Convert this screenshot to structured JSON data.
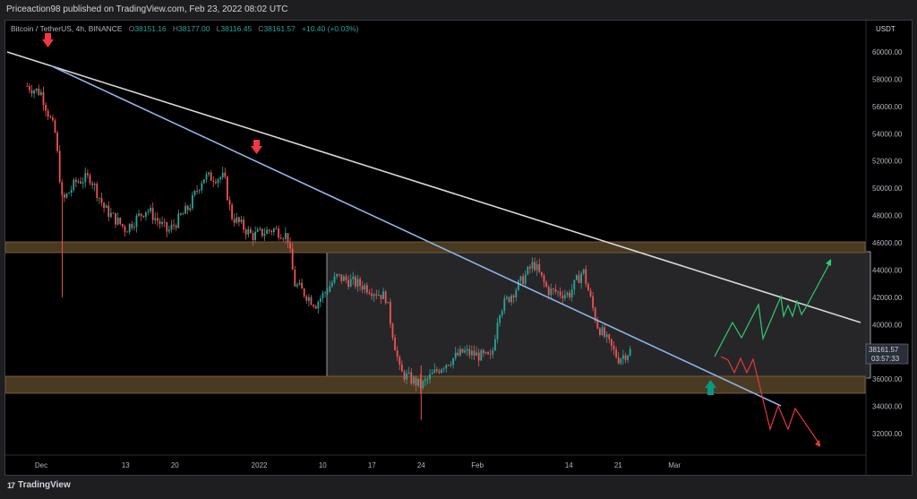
{
  "header": {
    "published": "Priceaction98 published on TradingView.com, Feb 23, 2022 08:02 UTC"
  },
  "legend": {
    "symbol": "Bitcoin / TetherUS, 4h, BINANCE",
    "o_label": "O",
    "o_value": "38151.16",
    "h_label": "H",
    "h_value": "38177.00",
    "l_label": "L",
    "l_value": "38116.45",
    "c_label": "C",
    "c_value": "38161.57",
    "change": "+10.40 (+0.03%)"
  },
  "branding": {
    "name": "TradingView",
    "mark": "17"
  },
  "price_tag": {
    "price": "38161.57",
    "countdown": "03:57:33"
  },
  "colors": {
    "up": "#26a69a",
    "down": "#ef5350",
    "zone": "#4a3a22",
    "range_box": "#262628",
    "white_line": "#d8d8d8",
    "blue_line": "#8cb4e8",
    "green_path": "#2ecc71",
    "red_path": "#e53935",
    "arrow_red": "#f23645",
    "arrow_green": "#089981"
  },
  "chart_data": {
    "type": "candlestick",
    "currency": "USDT",
    "x_ticks": [
      "Dec",
      "13",
      "20",
      "2022",
      "10",
      "17",
      "24",
      "Feb",
      "14",
      "21",
      "Mar"
    ],
    "y_ticks": [
      "60000.00",
      "58000.00",
      "56000.00",
      "54000.00",
      "52000.00",
      "50000.00",
      "48000.00",
      "46000.00",
      "44000.00",
      "42000.00",
      "40000.00",
      "38000.00",
      "36000.00",
      "34000.00",
      "32000.00"
    ],
    "ylim": [
      31000,
      62000
    ],
    "series": [
      {
        "values": [
          {
            "x": "Nov 29",
            "close": 57500
          },
          {
            "x": "Dec 1",
            "close": 57000
          },
          {
            "x": "Dec 3",
            "close": 54000
          },
          {
            "x": "Dec 4",
            "close": 49000
          },
          {
            "x": "Dec 6",
            "close": 50500
          },
          {
            "x": "Dec 8",
            "close": 50800
          },
          {
            "x": "Dec 10",
            "close": 48500
          },
          {
            "x": "Dec 13",
            "close": 47000
          },
          {
            "x": "Dec 16",
            "close": 48500
          },
          {
            "x": "Dec 19",
            "close": 46800
          },
          {
            "x": "Dec 22",
            "close": 48600
          },
          {
            "x": "Dec 24",
            "close": 50800
          },
          {
            "x": "Dec 27",
            "close": 50800
          },
          {
            "x": "Dec 28",
            "close": 48000
          },
          {
            "x": "Dec 31",
            "close": 46500
          },
          {
            "x": "Jan 3",
            "close": 47000
          },
          {
            "x": "Jan 5",
            "close": 46500
          },
          {
            "x": "Jan 6",
            "close": 43000
          },
          {
            "x": "Jan 9",
            "close": 41500
          },
          {
            "x": "Jan 12",
            "close": 43500
          },
          {
            "x": "Jan 16",
            "close": 42800
          },
          {
            "x": "Jan 19",
            "close": 42000
          },
          {
            "x": "Jan 21",
            "close": 36500
          },
          {
            "x": "Jan 24",
            "close": 35500
          },
          {
            "x": "Jan 27",
            "close": 37000
          },
          {
            "x": "Jan 30",
            "close": 38000
          },
          {
            "x": "Feb 3",
            "close": 37500
          },
          {
            "x": "Feb 4",
            "close": 41000
          },
          {
            "x": "Feb 7",
            "close": 43000
          },
          {
            "x": "Feb 9",
            "close": 44500
          },
          {
            "x": "Feb 11",
            "close": 42500
          },
          {
            "x": "Feb 14",
            "close": 42200
          },
          {
            "x": "Feb 16",
            "close": 44000
          },
          {
            "x": "Feb 18",
            "close": 40000
          },
          {
            "x": "Feb 21",
            "close": 37500
          },
          {
            "x": "Feb 23",
            "close": 38161.57
          }
        ]
      }
    ]
  }
}
